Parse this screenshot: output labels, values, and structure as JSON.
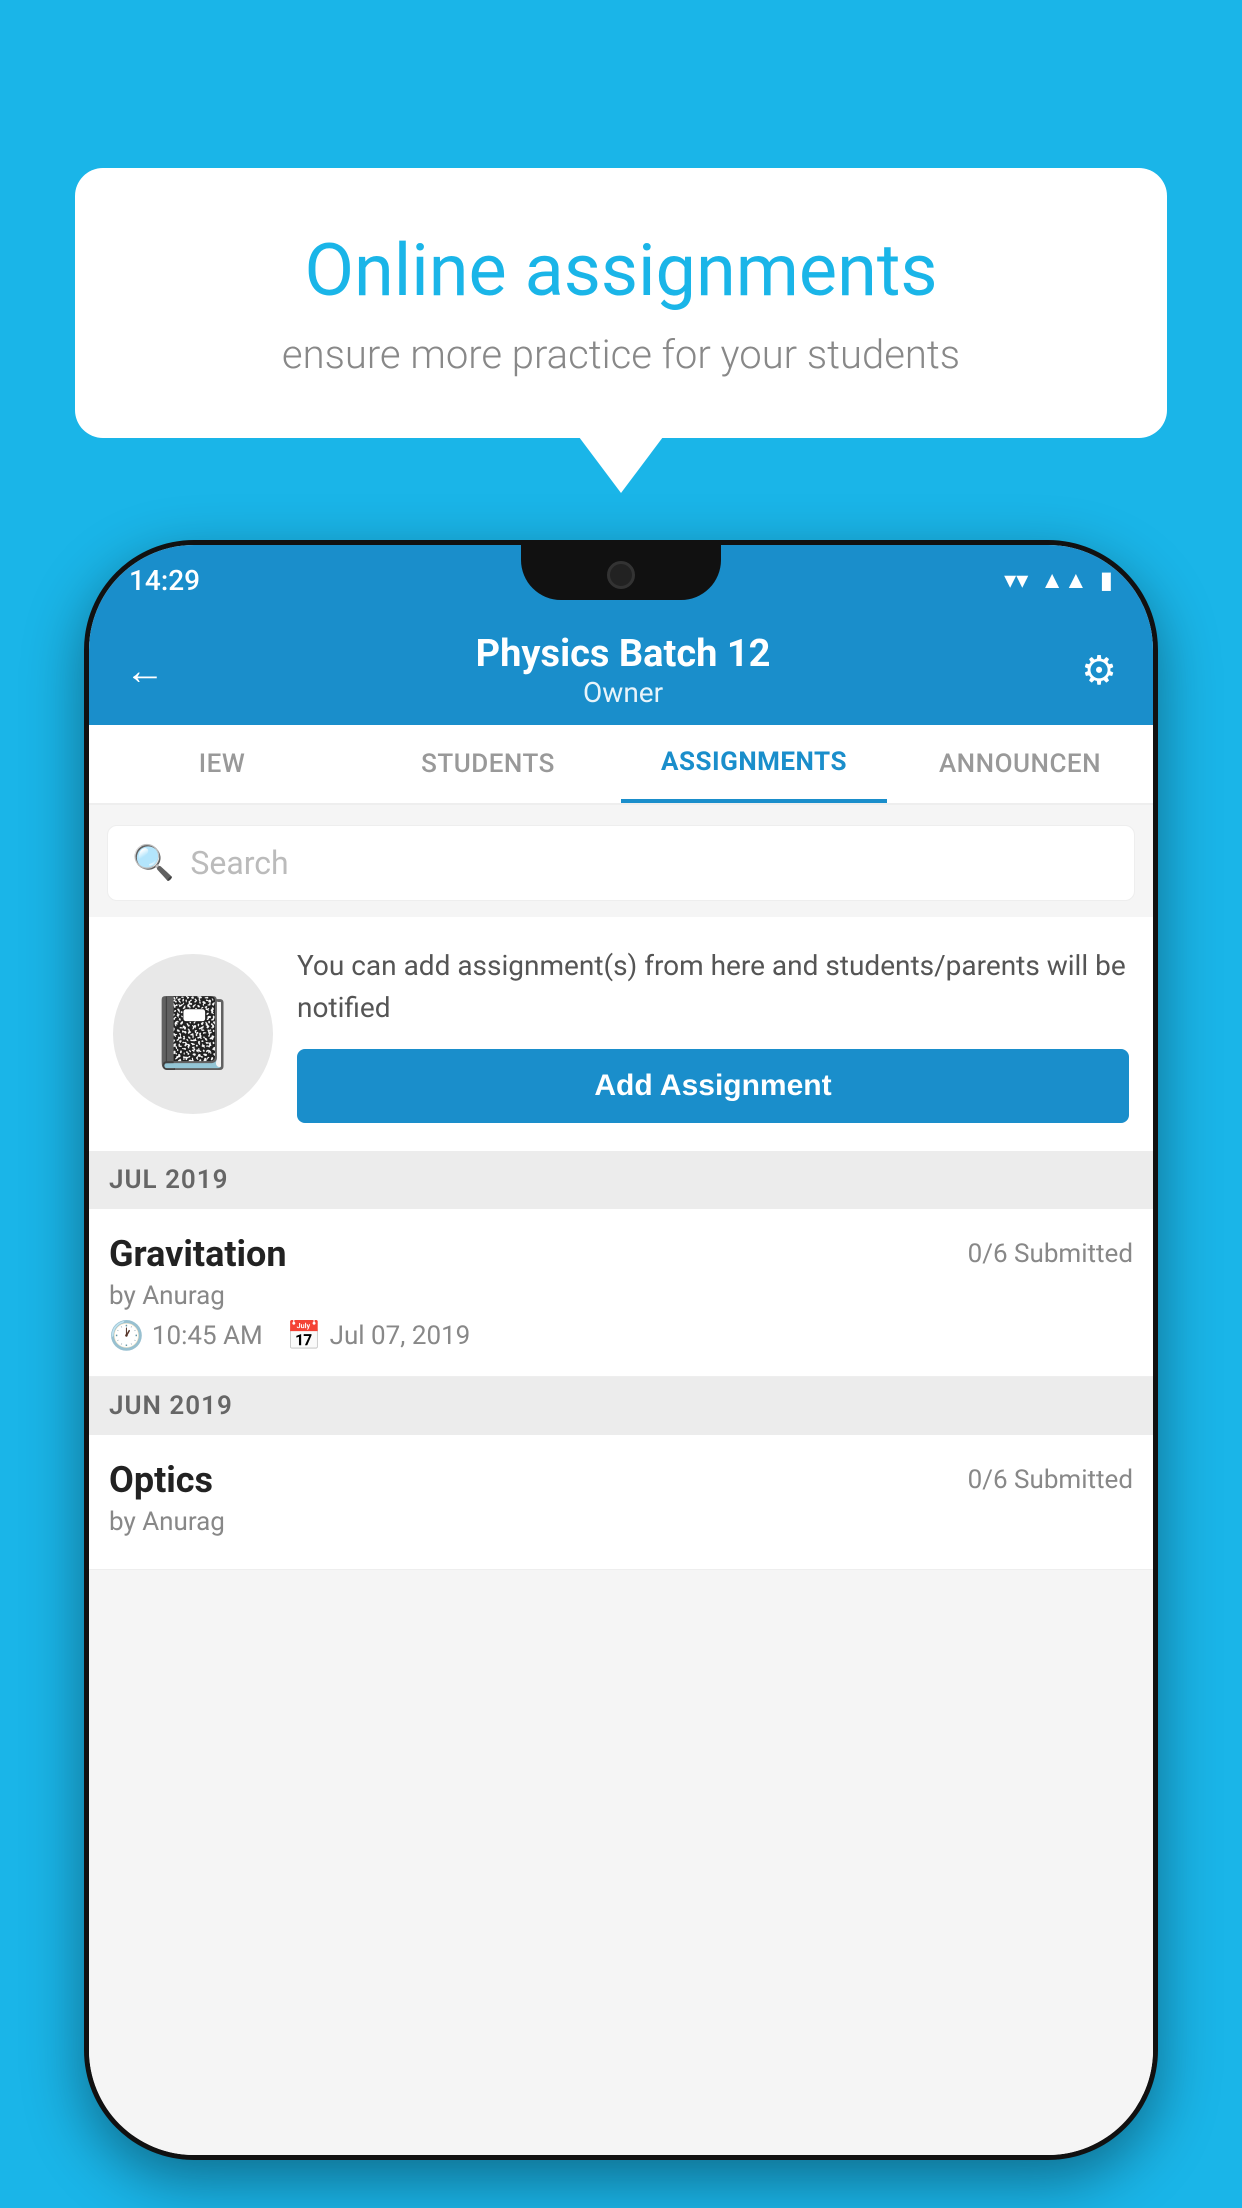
{
  "background_color": "#1ab5e8",
  "speech_bubble": {
    "title": "Online assignments",
    "subtitle": "ensure more practice for your students"
  },
  "status_bar": {
    "time": "14:29",
    "wifi": "▼",
    "signal": "▲",
    "battery": "▮"
  },
  "header": {
    "title": "Physics Batch 12",
    "subtitle": "Owner",
    "back_label": "←",
    "gear_label": "⚙"
  },
  "tabs": [
    {
      "label": "IEW",
      "active": false
    },
    {
      "label": "STUDENTS",
      "active": false
    },
    {
      "label": "ASSIGNMENTS",
      "active": true
    },
    {
      "label": "ANNOUNCEN",
      "active": false
    }
  ],
  "search": {
    "placeholder": "Search"
  },
  "promo": {
    "text": "You can add assignment(s) from here and students/parents will be notified",
    "button_label": "Add Assignment"
  },
  "sections": [
    {
      "label": "JUL 2019",
      "assignments": [
        {
          "name": "Gravitation",
          "submitted": "0/6 Submitted",
          "by": "by Anurag",
          "time": "10:45 AM",
          "date": "Jul 07, 2019"
        }
      ]
    },
    {
      "label": "JUN 2019",
      "assignments": [
        {
          "name": "Optics",
          "submitted": "0/6 Submitted",
          "by": "by Anurag",
          "time": "",
          "date": ""
        }
      ]
    }
  ]
}
